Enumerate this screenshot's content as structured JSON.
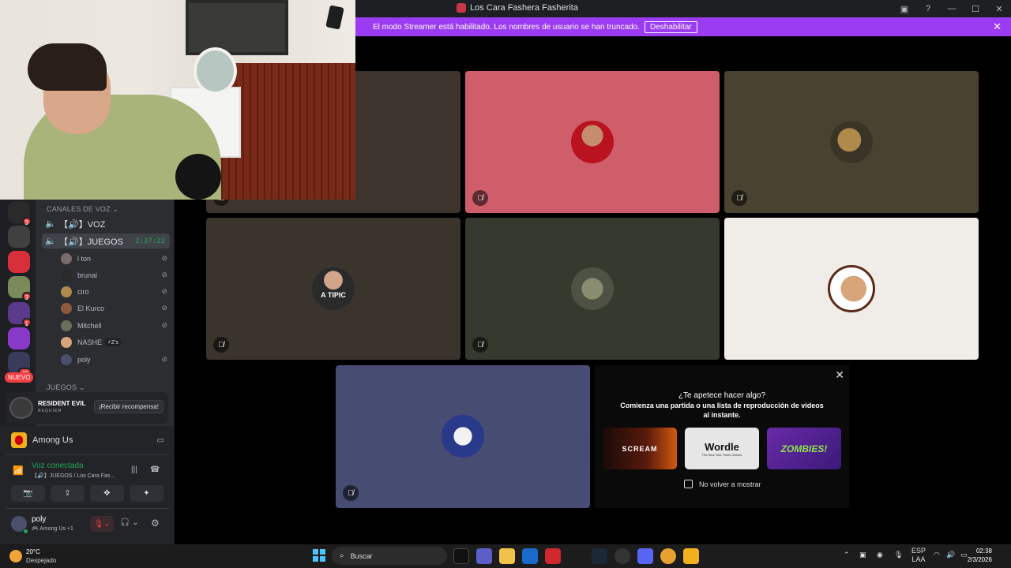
{
  "window": {
    "title": "Los Cara Fashera Fasherita",
    "controls": [
      "screen-icon",
      "help-icon",
      "minimize-icon",
      "maximize-icon",
      "close-icon"
    ]
  },
  "banner": {
    "text": "El modo Streamer está habilitado. Los nombres de usuario se han truncado.",
    "button": "Deshabilitar",
    "color": "#9b3cf2"
  },
  "rail": {
    "badges": [
      "3",
      "3",
      "1",
      "40"
    ],
    "new_label": "NUEVO"
  },
  "sidebar": {
    "voice_category": "CANALES DE VOZ",
    "games_category": "JUEGOS",
    "channels": [
      {
        "name": "【🔊】VOZ",
        "time": ""
      },
      {
        "name": "【🔊】JUEGOS",
        "time": "2:37:22"
      }
    ],
    "members": [
      {
        "name": "l ton"
      },
      {
        "name": "brunai"
      },
      {
        "name": "ciro"
      },
      {
        "name": "El Kurco"
      },
      {
        "name": "Mitchell"
      },
      {
        "name": "NASHE",
        "tag": "⚡Z's"
      },
      {
        "name": "poly"
      }
    ],
    "promo": {
      "game": "RESIDENT EVIL",
      "subtitle": "REQUIEM",
      "button": "¡Recibir recompensa!"
    }
  },
  "panel": {
    "activity": "Among Us",
    "voice_status": "Voz conectada",
    "voice_channel": "【🔊】JUEGOS / Los Cara Fas...",
    "user_name": "poly",
    "user_activity": "🎮 Among Us +1"
  },
  "stage": {
    "activity": {
      "question": "¿Te apetece hacer algo?",
      "description": "Comienza una partida o una lista de reproducción de videos al instante.",
      "cards": [
        "SCREAM",
        "Wordle",
        "ZOMBIES!"
      ],
      "wordle_sub": "The New York Times Games",
      "checkbox": "No volver a mostrar"
    },
    "tile_colors": [
      "#3d352d",
      "#d05e6a",
      "#4a4230",
      "#3a342c",
      "#363a2e",
      "#f0ede8",
      "#464c72"
    ],
    "avatar_overlay_text": "A TIPIC"
  },
  "taskbar": {
    "weather_temp": "20°C",
    "weather_cond": "Despejado",
    "search": "Buscar",
    "lang1": "ESP",
    "lang2": "LAA",
    "time": "02:38",
    "date": "2/3/2026"
  }
}
